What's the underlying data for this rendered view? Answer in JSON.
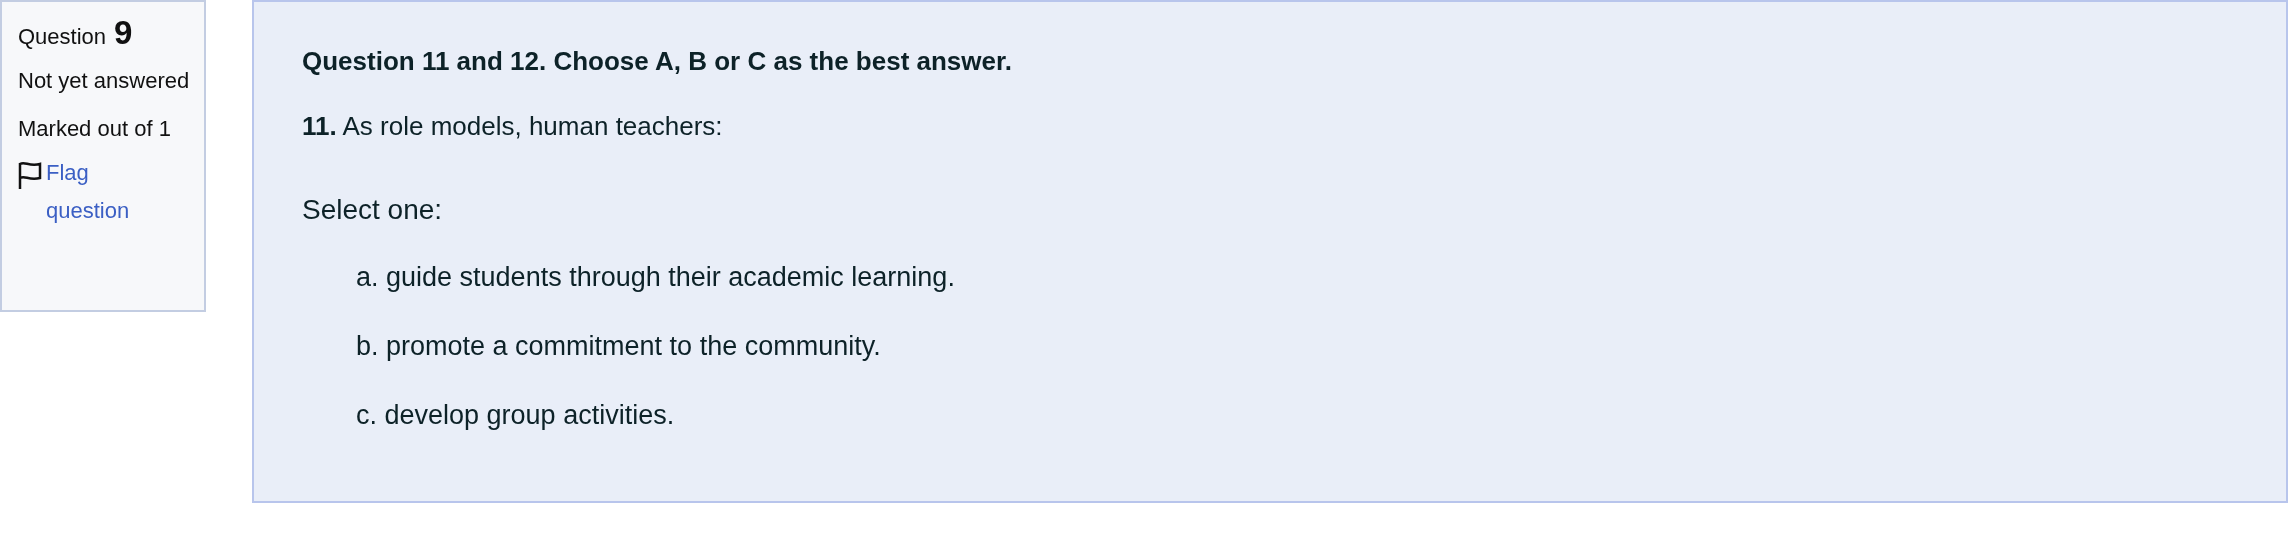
{
  "info": {
    "label": "Question",
    "number": "9",
    "status": "Not yet answered",
    "marks": "Marked out of 1",
    "flag_link": "Flag question"
  },
  "question": {
    "heading": "Question 11 and 12. Choose A, B or C as the best answer.",
    "prompt": "**11.** As role models, human teachers:",
    "instruction": "Select one:",
    "options": [
      {
        "text": "a. guide students through their academic learning."
      },
      {
        "text": "b. promote a commitment to the community."
      },
      {
        "text": "c. develop group activities."
      }
    ]
  }
}
